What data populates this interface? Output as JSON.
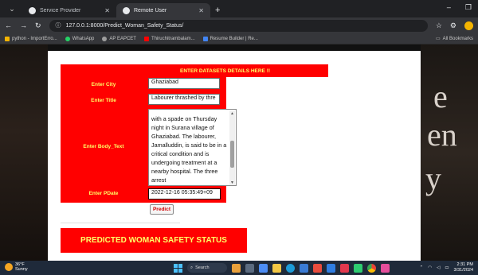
{
  "browser": {
    "tabs": [
      {
        "label": "Service Provider",
        "active": false
      },
      {
        "label": "Remote User",
        "active": true
      }
    ],
    "url": "127.0.0.1:8000/Predict_Woman_Safety_Status/",
    "bookmarks": [
      {
        "label": "python - ImportErro...",
        "color": "#f4b400"
      },
      {
        "label": "WhatsApp",
        "color": "#25d366"
      },
      {
        "label": "AP EAPCET",
        "color": "#9e9e9e"
      },
      {
        "label": "Thiruchitrambalam...",
        "color": "#ff0000"
      },
      {
        "label": "Resume Builder | Re...",
        "color": "#4285f4"
      }
    ],
    "all_bookmarks": "All Bookmarks"
  },
  "background": {
    "letter1": "e",
    "letter2": "en",
    "letter3": "y"
  },
  "form": {
    "banner": "ENTER DATASETS DETAILS HERE !!",
    "city_label": "Enter City",
    "city_value": "Ghaziabad",
    "title_label": "Enter Title",
    "title_value": "Labourer thrashed by thre",
    "body_label": "Enter Body_Text",
    "body_lines": [
      "with a spade on Thursday",
      "night in Surana village of",
      "Ghaziabad.  The labourer,",
      "Jamalluddin, is said to be in a",
      "critical condition and is",
      "undergoing treatment at a",
      "nearby hospital. The three",
      "arrest"
    ],
    "pdate_label": "Enter PDate",
    "pdate_value": "2022-12-16 05:35:49+09",
    "predict_label": "Predict"
  },
  "result": {
    "banner": "PREDICTED WOMAN SAFETY STATUS"
  },
  "taskbar": {
    "weather_temp": "36°F",
    "weather_desc": "Sunny",
    "search_label": "Search",
    "time": "2:31 PM",
    "date": "3/31/2024"
  }
}
